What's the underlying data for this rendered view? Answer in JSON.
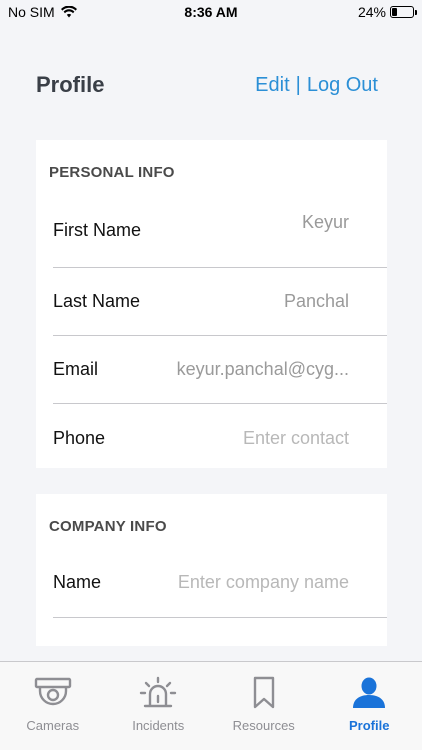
{
  "status": {
    "carrier": "No SIM",
    "time": "8:36 AM",
    "battery": "24%",
    "battery_level": 0.24
  },
  "header": {
    "title": "Profile",
    "edit": "Edit",
    "separator": "|",
    "logout": "Log Out"
  },
  "personal": {
    "title": "PERSONAL INFO",
    "rows": [
      {
        "label": "First Name",
        "value": "Keyur"
      },
      {
        "label": "Last Name",
        "value": "Panchal"
      },
      {
        "label": "Email",
        "value": "keyur.panchal@cyg..."
      },
      {
        "label": "Phone",
        "placeholder": "Enter contact"
      }
    ]
  },
  "company": {
    "title": "COMPANY INFO",
    "rows": [
      {
        "label": "Name",
        "placeholder": "Enter company name"
      }
    ]
  },
  "tabs": [
    {
      "label": "Cameras",
      "icon": "camera-icon"
    },
    {
      "label": "Incidents",
      "icon": "alarm-icon"
    },
    {
      "label": "Resources",
      "icon": "bookmark-icon"
    },
    {
      "label": "Profile",
      "icon": "person-icon",
      "active": true
    }
  ],
  "colors": {
    "accent": "#2b8fd6",
    "tab_active": "#1a73d9",
    "tab_inactive": "#8e8e93"
  }
}
